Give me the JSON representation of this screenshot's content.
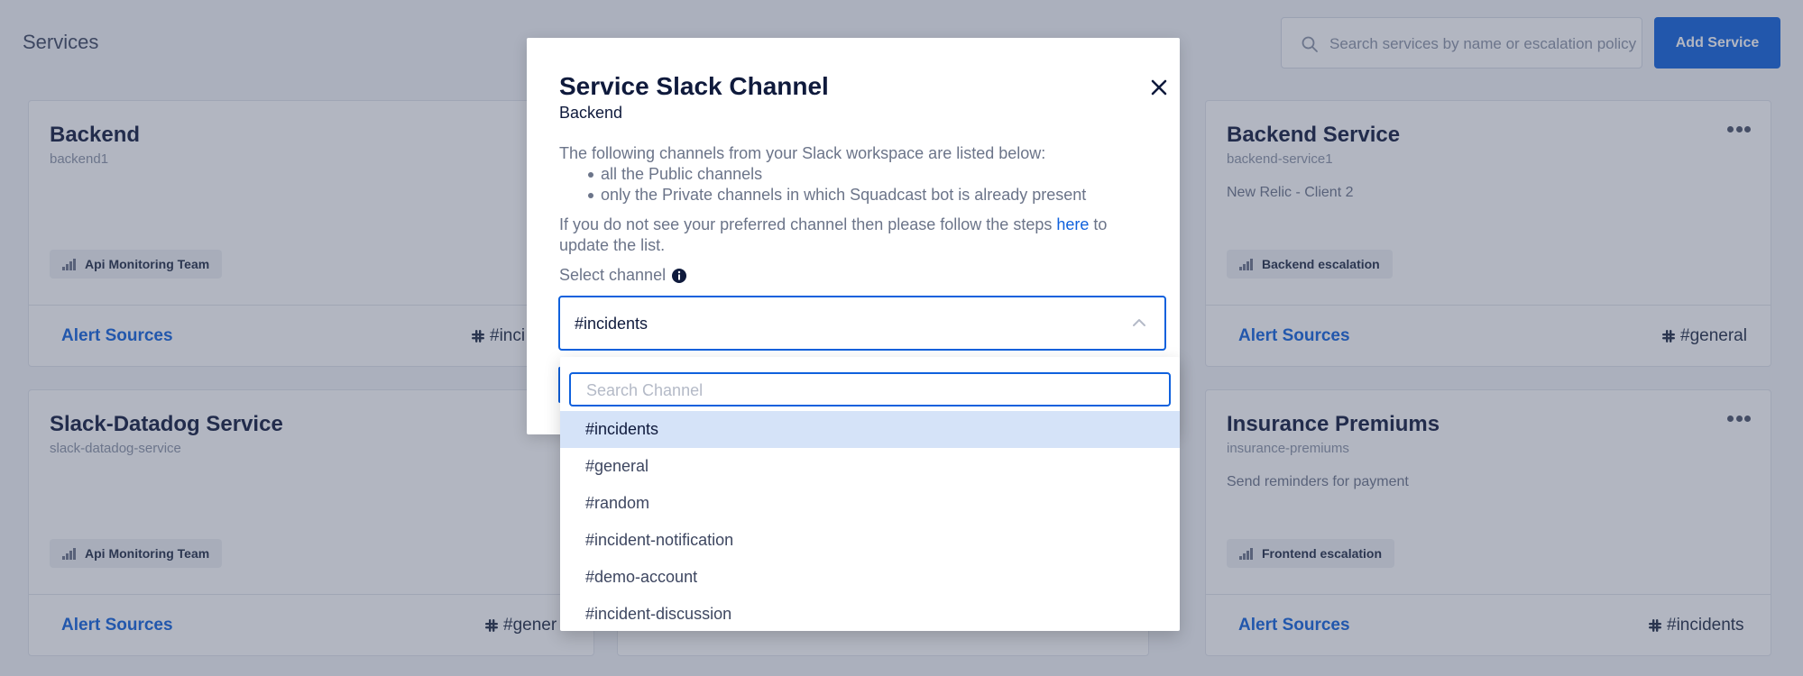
{
  "page": {
    "title": "Services",
    "search_placeholder": "Search services by name or escalation policy",
    "add_button": "Add Service"
  },
  "cards": [
    {
      "title": "Backend",
      "slug": "backend1",
      "description": "",
      "tag": "Api Monitoring Team",
      "alert_sources": "Alert Sources",
      "slack_channel": "#inci"
    },
    {
      "title": "Backend Service",
      "slug": "backend-service1",
      "description": "New Relic - Client 2",
      "tag": "Backend escalation",
      "alert_sources": "Alert Sources",
      "slack_channel": "#general"
    },
    {
      "title": "Slack-Datadog Service",
      "slug": "slack-datadog-service",
      "description": "",
      "tag": "Api Monitoring Team",
      "alert_sources": "Alert Sources",
      "slack_channel": "#gener"
    },
    {
      "title": "Insurance Premiums",
      "slug": "insurance-premiums",
      "description": "Send reminders for payment",
      "tag": "Frontend escalation",
      "alert_sources": "Alert Sources",
      "slack_channel": "#incidents"
    }
  ],
  "modal": {
    "title": "Service Slack Channel",
    "subtitle": "Backend",
    "intro": "The following channels from your Slack workspace are listed below:",
    "bullets": [
      "all the Public channels",
      "only the Private channels in which Squadcast bot is already present"
    ],
    "help_prefix": "If you do not see your preferred channel then please follow the steps ",
    "help_link": "here",
    "help_suffix": " to update the list.",
    "select_label": "Select channel",
    "selected_value": "#incidents"
  },
  "dropdown": {
    "search_placeholder": "Search Channel",
    "options": [
      "#incidents",
      "#general",
      "#random",
      "#incident-notification",
      "#demo-account",
      "#incident-discussion"
    ],
    "selected_index": 0
  },
  "colors": {
    "accent": "#0f61dd",
    "overlay": "#3e4963",
    "selected_option": "#d5e3f8"
  }
}
